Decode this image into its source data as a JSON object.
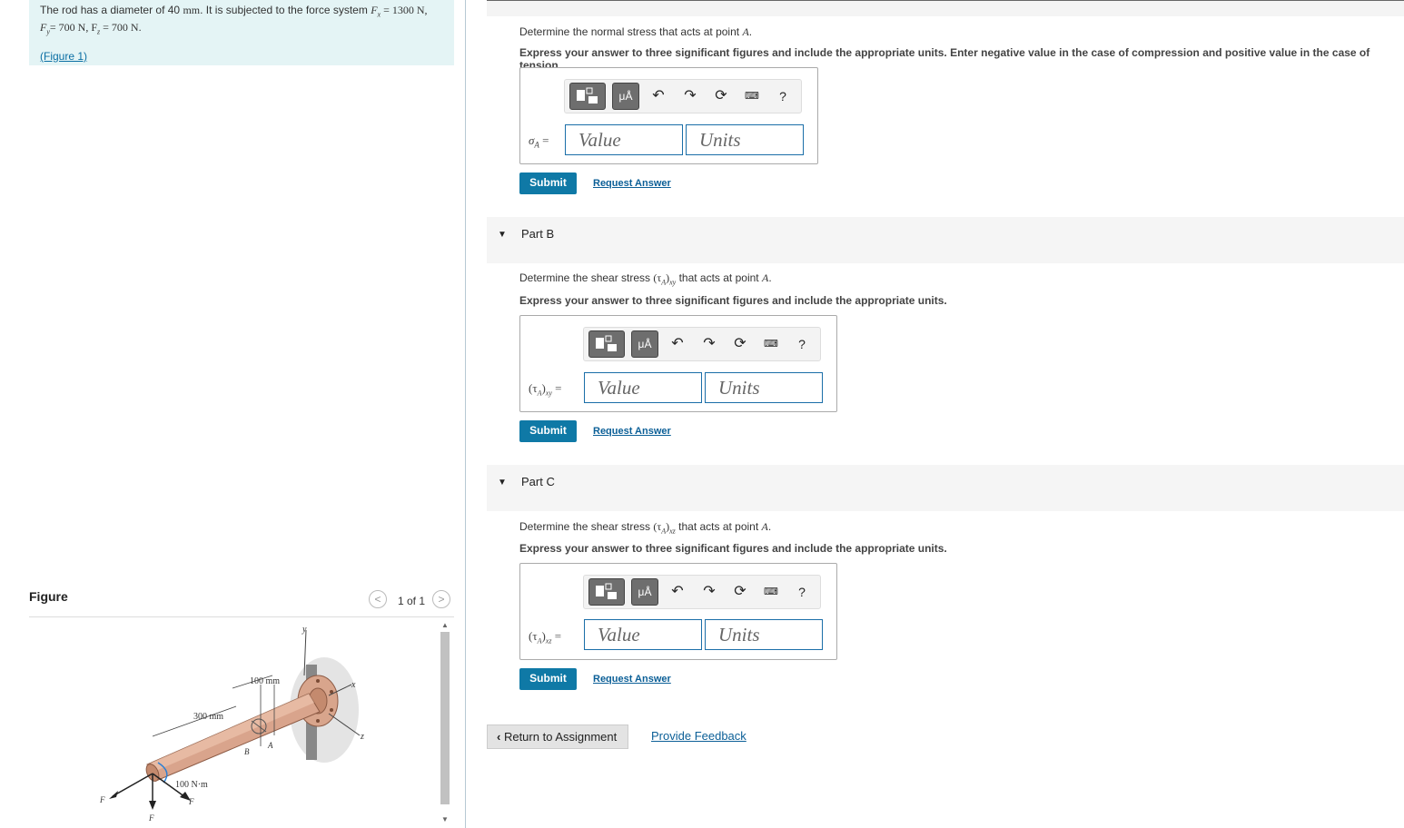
{
  "problem": {
    "text_prefix": "The rod has a diameter of 40 ",
    "text_unit": "mm",
    "text_mid": ". It is subjected to the force system ",
    "fx": "F",
    "fx_sub": "x",
    "fx_val": " = 1300 N,",
    "line2": "= 700 N, F",
    "fy_sub": "y",
    "fz_sub": "z",
    "line2_end": " = 700 N.",
    "figure_link": "(Figure 1)"
  },
  "figure": {
    "title": "Figure",
    "counter": "1 of 1",
    "prev_icon": "chevron-left-icon",
    "next_icon": "chevron-right-icon",
    "labels": {
      "y": "y",
      "x": "x",
      "z": "z",
      "dim_100": "100 mm",
      "dim_300": "300 mm",
      "moment": "100 N·m",
      "B": "B",
      "A": "A",
      "Fx": "F",
      "Fy": "F",
      "Fz": "F",
      "Fx_sub": "x",
      "Fy_sub": "y",
      "Fz_sub": "z"
    }
  },
  "partA": {
    "question_pre": "Determine the normal stress that acts at point ",
    "question_point": "A",
    "question_post": ".",
    "instructions": "Express your answer to three significant figures and include the appropriate units. Enter negative value in the case of compression and positive value in the case of tension.",
    "label": "σ",
    "label_sub": "A",
    "label_eq": " =",
    "value_placeholder": "Value",
    "units_placeholder": "Units",
    "submit": "Submit",
    "request": "Request Answer"
  },
  "partB": {
    "title": "Part B",
    "question_pre": "Determine the shear stress ",
    "question_sym": "(τ",
    "question_sym_sub": "A",
    "question_sym_close": ")",
    "question_sym_sub2": "xy",
    "question_post": " that acts at point ",
    "question_point": "A",
    "question_end": ".",
    "instructions": "Express your answer to three significant figures and include the appropriate units.",
    "label": "(τ",
    "label_sub": "A",
    "label_close": ")",
    "label_sub2": "xy",
    "label_eq": " =",
    "value_placeholder": "Value",
    "units_placeholder": "Units",
    "submit": "Submit",
    "request": "Request Answer"
  },
  "partC": {
    "title": "Part C",
    "question_pre": "Determine the shear stress ",
    "question_sym": "(τ",
    "question_sym_sub": "A",
    "question_sym_close": ")",
    "question_sym_sub2": "xz",
    "question_post": " that acts at point ",
    "question_point": "A",
    "question_end": ".",
    "instructions": "Express your answer to three significant figures and include the appropriate units.",
    "label": "(τ",
    "label_sub": "A",
    "label_close": ")",
    "label_sub2": "xz",
    "label_eq": " =",
    "value_placeholder": "Value",
    "units_placeholder": "Units",
    "submit": "Submit",
    "request": "Request Answer"
  },
  "toolbar": {
    "template_icon": "template-icon",
    "units_btn": "μÅ",
    "undo_icon": "undo-icon",
    "redo_icon": "redo-icon",
    "reset_icon": "reset-icon",
    "keyboard_icon": "keyboard-icon",
    "help": "?"
  },
  "footer": {
    "return": "Return to Assignment",
    "feedback": "Provide Feedback"
  },
  "colors": {
    "submit": "#0f79a6",
    "link": "#0b5f97",
    "problem_bg": "#e4f4f5"
  }
}
